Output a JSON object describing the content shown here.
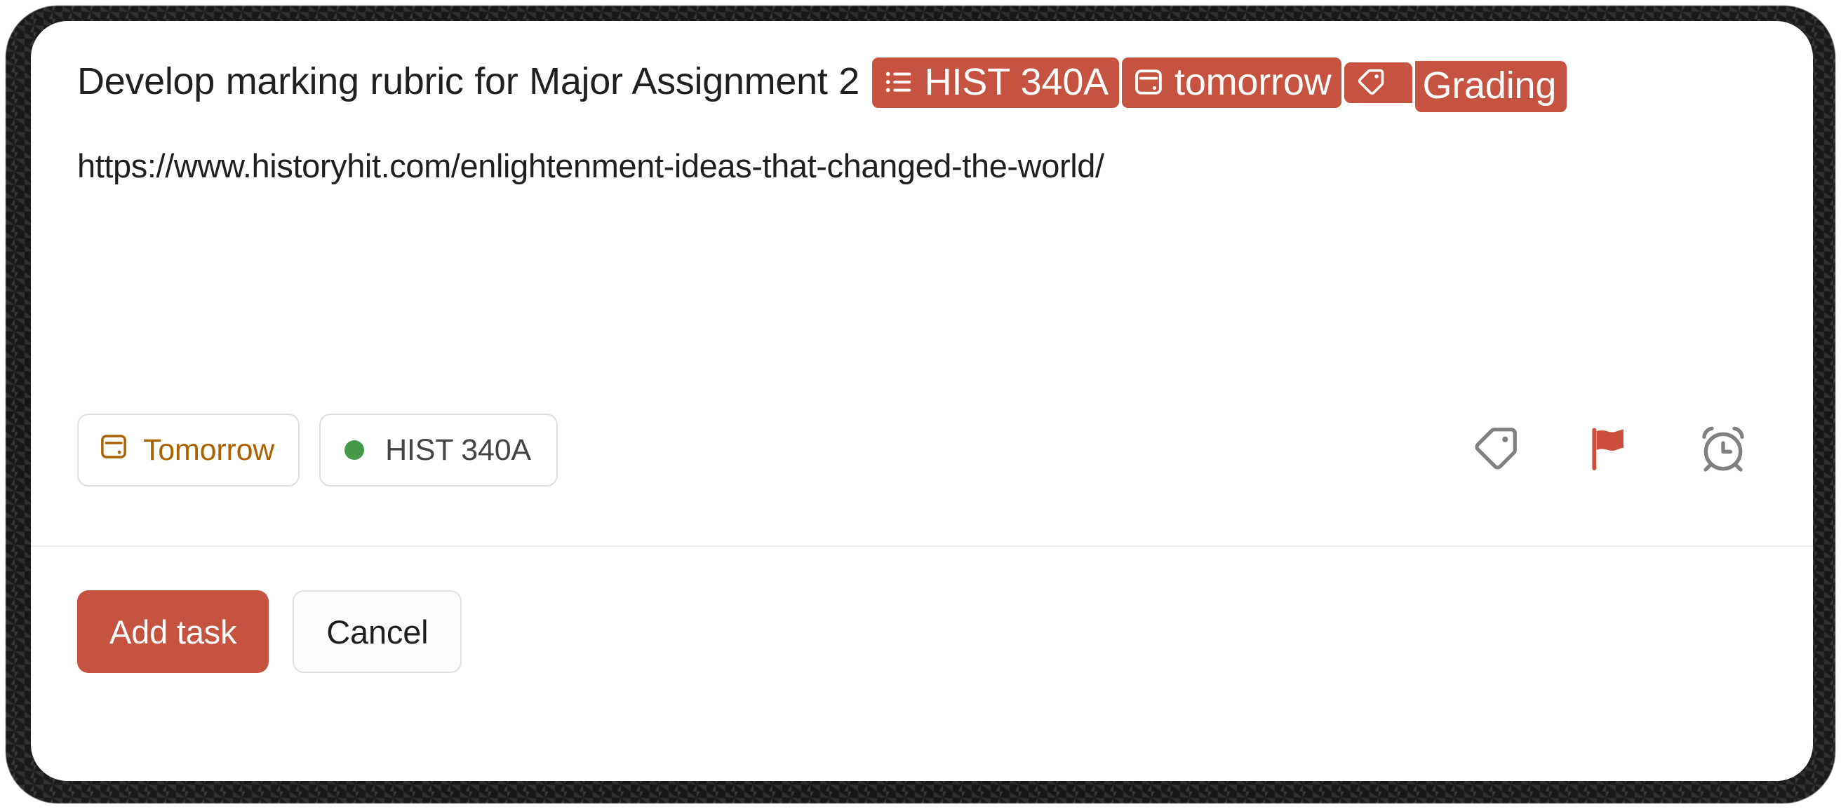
{
  "dialog": {
    "name": "quick-add-task-dialog",
    "accent_color": "#c5533f",
    "date_color": "#ad6200",
    "project_dot_color": "#449a47"
  },
  "task": {
    "title_part_1": "Develop marking rubric for Major Assignment 2 ",
    "chips": [
      {
        "icon": "list-icon",
        "label": "HIST 340A"
      },
      {
        "icon": "calendar-icon",
        "label": "tomorrow"
      },
      {
        "icon": "tag-icon",
        "label": ""
      },
      {
        "icon": "",
        "label": "Grading"
      }
    ],
    "description": "https://www.historyhit.com/enlightenment-ideas-that-changed-the-world/"
  },
  "attributes": {
    "date_label": "Tomorrow",
    "date_icon": "calendar-icon",
    "project_label": "HIST 340A",
    "actions": [
      {
        "icon": "tag-icon",
        "name": "labels-button"
      },
      {
        "icon": "flag-icon",
        "name": "priority-button"
      },
      {
        "icon": "alarm-clock-icon",
        "name": "reminders-button"
      }
    ]
  },
  "footer": {
    "submit_label": "Add task",
    "cancel_label": "Cancel"
  }
}
